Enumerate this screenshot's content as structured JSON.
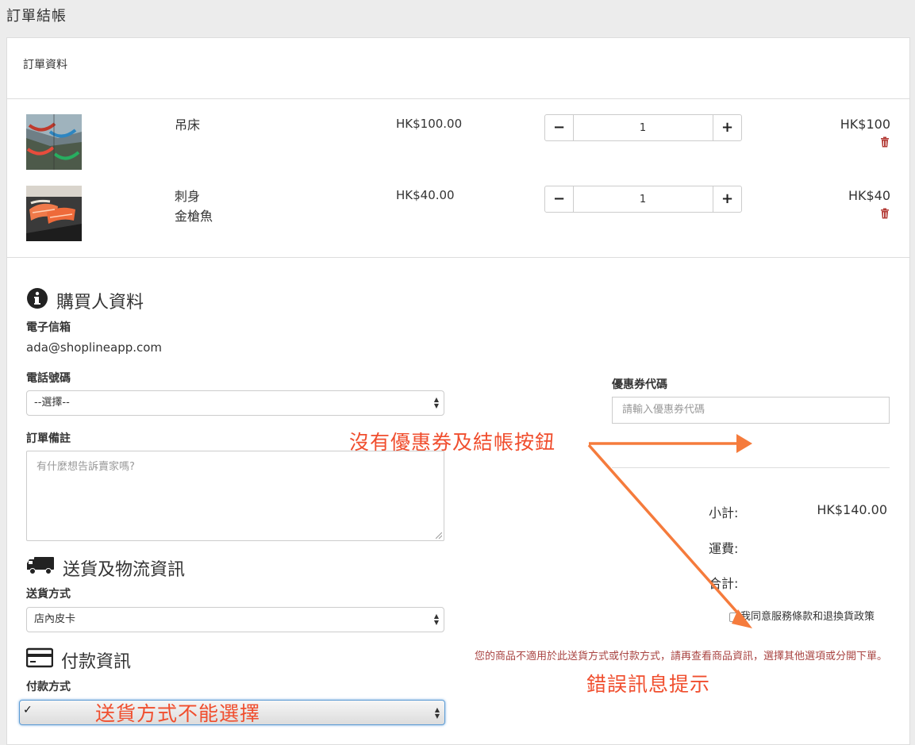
{
  "page_title": "訂單結帳",
  "order_section": {
    "title": "訂單資料",
    "items": [
      {
        "name": "吊床",
        "variant": "",
        "price": "HK$100.00",
        "quantity": "1",
        "total": "HK$100"
      },
      {
        "name": "刺身",
        "variant": "金槍魚",
        "price": "HK$40.00",
        "quantity": "1",
        "total": "HK$40"
      }
    ]
  },
  "buyer": {
    "heading": "購買人資料",
    "email_label": "電子信箱",
    "email_value": "ada@shoplineapp.com",
    "phone_label": "電話號碼",
    "phone_value": "--選擇--",
    "note_label": "訂單備註",
    "note_placeholder": "有什麼想告訴賣家嗎?"
  },
  "delivery": {
    "heading": "送貨及物流資訊",
    "method_label": "送貨方式",
    "method_value": "店內皮卡"
  },
  "payment": {
    "heading": "付款資訊",
    "method_label": "付款方式",
    "method_value": "✓"
  },
  "coupon": {
    "label": "優惠券代碼",
    "placeholder": "請輸入優惠券代碼"
  },
  "summary": {
    "subtotal_label": "小計:",
    "subtotal_value": "HK$140.00",
    "shipping_label": "運費:",
    "total_label": "合計:",
    "agree_text": "我同意服務條款和退換貨政策"
  },
  "error_message": "您的商品不適用於此送貨方式或付款方式，請再查看商品資訊，選擇其他選項或分開下單。",
  "annotations": {
    "no_coupon_checkout": "沒有優惠券及結帳按鈕",
    "error_hint": "錯誤訊息提示",
    "cannot_select_delivery": "送貨方式不能選擇"
  },
  "colors": {
    "annotation": "#f04e2e",
    "arrow": "#f57b3c",
    "error": "#a94442",
    "trash": "#b33b36"
  }
}
